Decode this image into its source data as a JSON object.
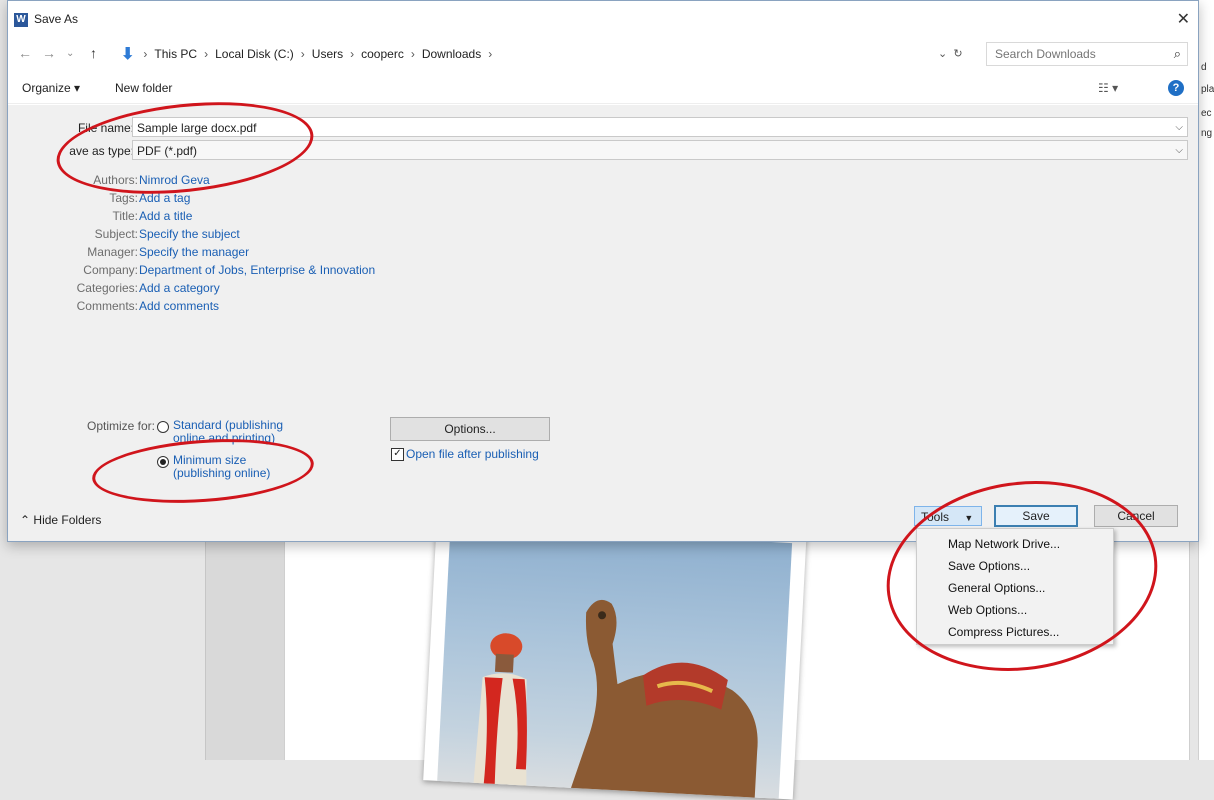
{
  "window": {
    "title": "Save As"
  },
  "nav": {
    "breadcrumbs": [
      "This PC",
      "Local Disk (C:)",
      "Users",
      "cooperc",
      "Downloads"
    ],
    "search_placeholder": "Search Downloads"
  },
  "toolbar": {
    "organize": "Organize ▾",
    "new_folder": "New folder"
  },
  "fields": {
    "file_name_label": "File name:",
    "file_name_value": "Sample large docx.pdf",
    "save_type_label": "ave as type:",
    "save_type_value": "PDF (*.pdf)"
  },
  "meta": [
    {
      "label": "Authors:",
      "value": "Nimrod Geva"
    },
    {
      "label": "Tags:",
      "value": "Add a tag"
    },
    {
      "label": "Title:",
      "value": "Add a title"
    },
    {
      "label": "Subject:",
      "value": "Specify the subject"
    },
    {
      "label": "Manager:",
      "value": "Specify the manager"
    },
    {
      "label": "Company:",
      "value": "Department of Jobs, Enterprise & Innovation"
    },
    {
      "label": "Categories:",
      "value": "Add a category"
    },
    {
      "label": "Comments:",
      "value": "Add comments"
    }
  ],
  "optimize": {
    "label": "Optimize for:",
    "standard_line1": "Standard (publishing",
    "standard_line2": "online and printing)",
    "minimum_line1": "Minimum size",
    "minimum_line2": "(publishing online)",
    "selected": "minimum"
  },
  "options_button": "Options...",
  "open_after": "Open file after publishing",
  "footer": {
    "hide_folders": "Hide Folders",
    "tools": "Tools",
    "save": "Save",
    "cancel": "Cancel"
  },
  "tools_menu": [
    "Map Network Drive...",
    "Save Options...",
    "General Options...",
    "Web Options...",
    "Compress Pictures..."
  ],
  "right_edge_fragments": [
    "d",
    "pla",
    "ec",
    "ng"
  ],
  "colors": {
    "annotation": "#d0151c",
    "link": "#1a5fb4",
    "word_brand": "#2b579a"
  }
}
